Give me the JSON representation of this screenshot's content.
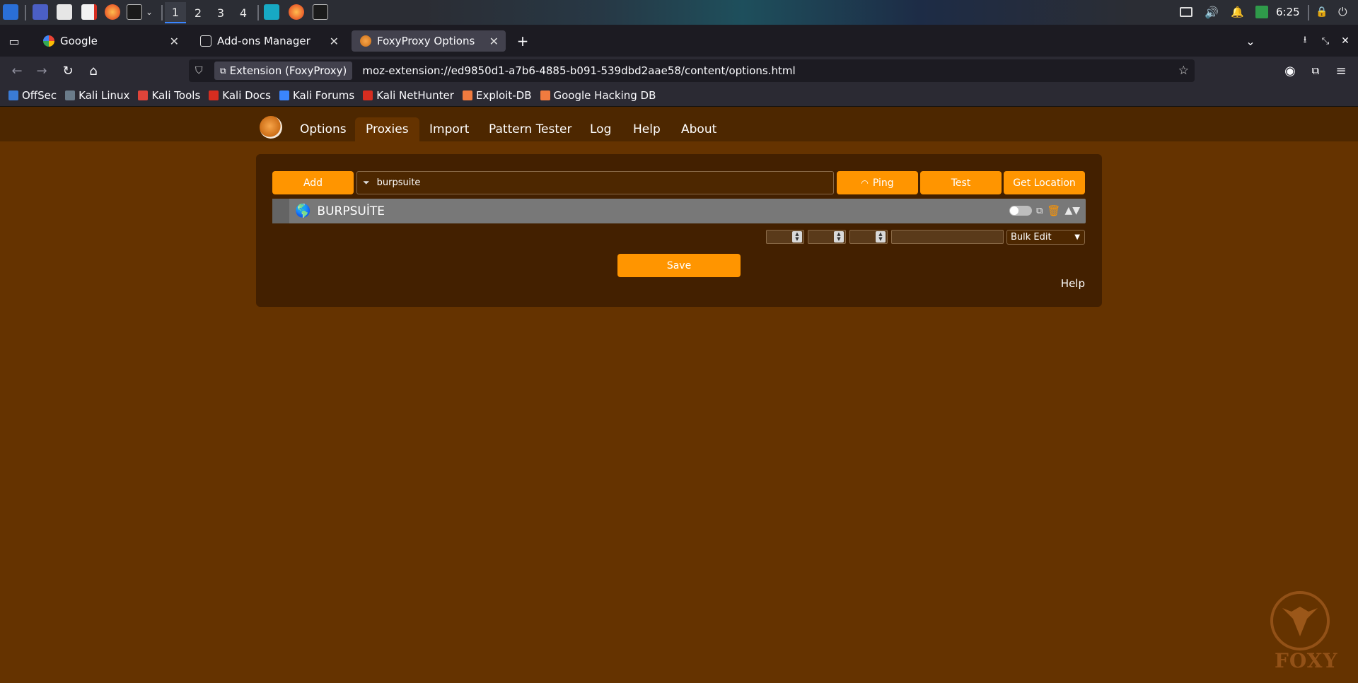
{
  "taskbar": {
    "workspaces": [
      "1",
      "2",
      "3",
      "4"
    ],
    "active_workspace": "1",
    "clock": "6:25",
    "icons": [
      "kali-menu-icon",
      "desktop-icon",
      "files-icon",
      "text-editor-icon",
      "firefox-icon",
      "terminal-icon",
      "burpsuite-icon",
      "firefox-icon",
      "terminal-icon"
    ],
    "tray_icons": [
      "display-icon",
      "volume-icon",
      "notification-bell-icon",
      "battery-icon",
      "lock-icon",
      "power-icon"
    ]
  },
  "browser": {
    "tabs": [
      {
        "label": "Google",
        "selected": false
      },
      {
        "label": "Add-ons Manager",
        "selected": false
      },
      {
        "label": "FoxyProxy Options",
        "selected": true
      }
    ],
    "url_chip": "Extension (FoxyProxy)",
    "url": "moz-extension://ed9850d1-a7b6-4885-b091-539dbd2aae58/content/options.html",
    "bookmarks": [
      {
        "label": "OffSec",
        "color": "#3a7bd5"
      },
      {
        "label": "Kali Linux",
        "color": "#6a7b8a"
      },
      {
        "label": "Kali Tools",
        "color": "#e0443a"
      },
      {
        "label": "Kali Docs",
        "color": "#d62d20"
      },
      {
        "label": "Kali Forums",
        "color": "#3a85ff"
      },
      {
        "label": "Kali NetHunter",
        "color": "#d62d20"
      },
      {
        "label": "Exploit-DB",
        "color": "#f07b3f"
      },
      {
        "label": "Google Hacking DB",
        "color": "#f07b3f"
      }
    ]
  },
  "foxyproxy": {
    "nav": [
      {
        "label": "Options",
        "active": false
      },
      {
        "label": "Proxies",
        "active": true
      },
      {
        "label": "Import",
        "active": false
      },
      {
        "label": "Pattern Tester",
        "active": false
      },
      {
        "label": "Log",
        "active": false
      },
      {
        "label": "Help",
        "active": false
      },
      {
        "label": "About",
        "active": false
      }
    ],
    "buttons": {
      "add": "Add",
      "ping": "Ping",
      "test": "Test",
      "get_location": "Get Location",
      "save": "Save"
    },
    "filter_value": "burpsuite",
    "proxy": {
      "title": "BURPSUİTE",
      "enabled": false
    },
    "bulk_edit": "Bulk Edit",
    "help_link": "Help",
    "watermark": "FOXY",
    "accent_color": "#ff9500",
    "page_bg": "#653300"
  }
}
